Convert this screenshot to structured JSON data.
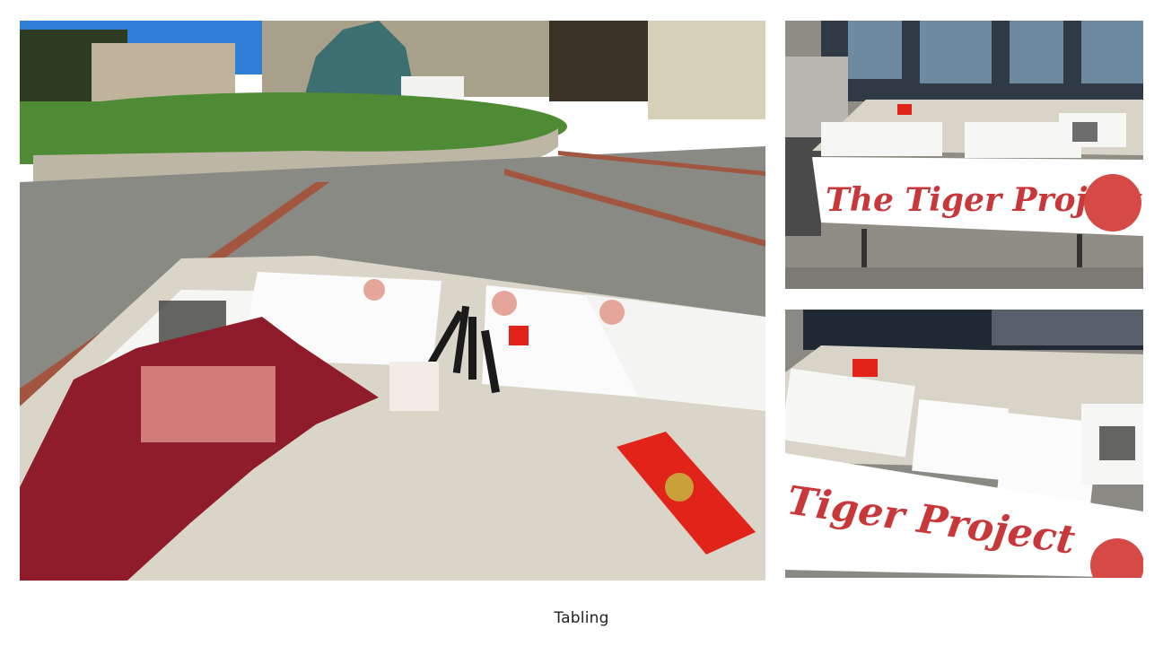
{
  "caption": "Tabling",
  "photos": [
    {
      "scene": "main-table-closeup",
      "banner_text": ""
    },
    {
      "scene": "table-front-view",
      "banner_text": "The Tiger Project"
    },
    {
      "scene": "table-side-view",
      "banner_text": "Tiger Project"
    }
  ],
  "colors": {
    "banner_red": "#c8373a",
    "envelope_red": "#e2231a",
    "bandana": "#8e1c2a",
    "table": "#d9d6c9",
    "pavement": "#8a8a85",
    "grass": "#4f8a35",
    "sky": "#2f7fd6"
  }
}
